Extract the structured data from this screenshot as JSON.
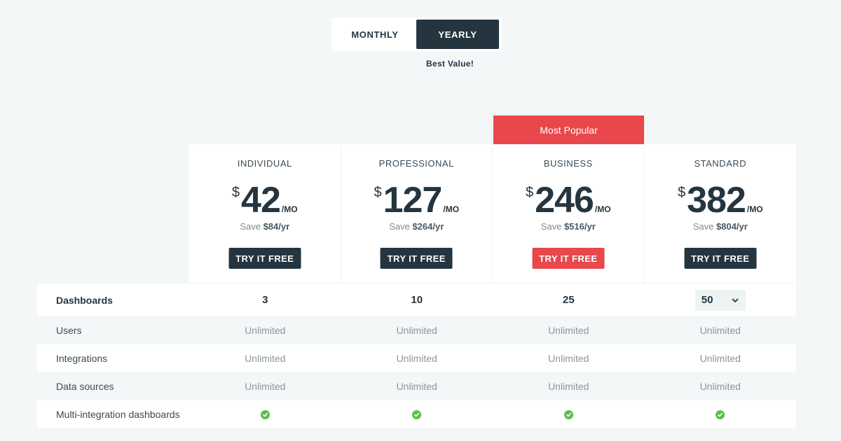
{
  "billing": {
    "monthly_label": "MONTHLY",
    "yearly_label": "YEARLY",
    "selected": "yearly",
    "best_value": "Best Value!"
  },
  "ribbon": {
    "label": "Most Popular"
  },
  "plans": [
    {
      "name": "INDIVIDUAL",
      "currency": "$",
      "price": "42",
      "period": "/MO",
      "save_prefix": "Save ",
      "save_amount": "$84",
      "save_suffix": "/yr",
      "cta": "TRY IT FREE"
    },
    {
      "name": "PROFESSIONAL",
      "currency": "$",
      "price": "127",
      "period": "/MO",
      "save_prefix": "Save ",
      "save_amount": "$264",
      "save_suffix": "/yr",
      "cta": "TRY IT FREE"
    },
    {
      "name": "BUSINESS",
      "currency": "$",
      "price": "246",
      "period": "/MO",
      "save_prefix": "Save ",
      "save_amount": "$516",
      "save_suffix": "/yr",
      "cta": "TRY IT FREE",
      "popular": true
    },
    {
      "name": "STANDARD",
      "currency": "$",
      "price": "382",
      "period": "/MO",
      "save_prefix": "Save ",
      "save_amount": "$804",
      "save_suffix": "/yr",
      "cta": "TRY IT FREE"
    }
  ],
  "features": {
    "dashboards": {
      "label": "Dashboards",
      "values": [
        "3",
        "10",
        "25"
      ],
      "select_value": "50"
    },
    "users": {
      "label": "Users",
      "values": [
        "Unlimited",
        "Unlimited",
        "Unlimited",
        "Unlimited"
      ]
    },
    "integrations": {
      "label": "Integrations",
      "values": [
        "Unlimited",
        "Unlimited",
        "Unlimited",
        "Unlimited"
      ]
    },
    "data_sources": {
      "label": "Data sources",
      "values": [
        "Unlimited",
        "Unlimited",
        "Unlimited",
        "Unlimited"
      ]
    },
    "multi_integration": {
      "label": "Multi-integration dashboards",
      "included": [
        true,
        true,
        true,
        true
      ]
    }
  },
  "colors": {
    "dark": "#253540",
    "accent": "#e8474b",
    "check": "#5bbf4a",
    "background": "#f3f7f7"
  }
}
